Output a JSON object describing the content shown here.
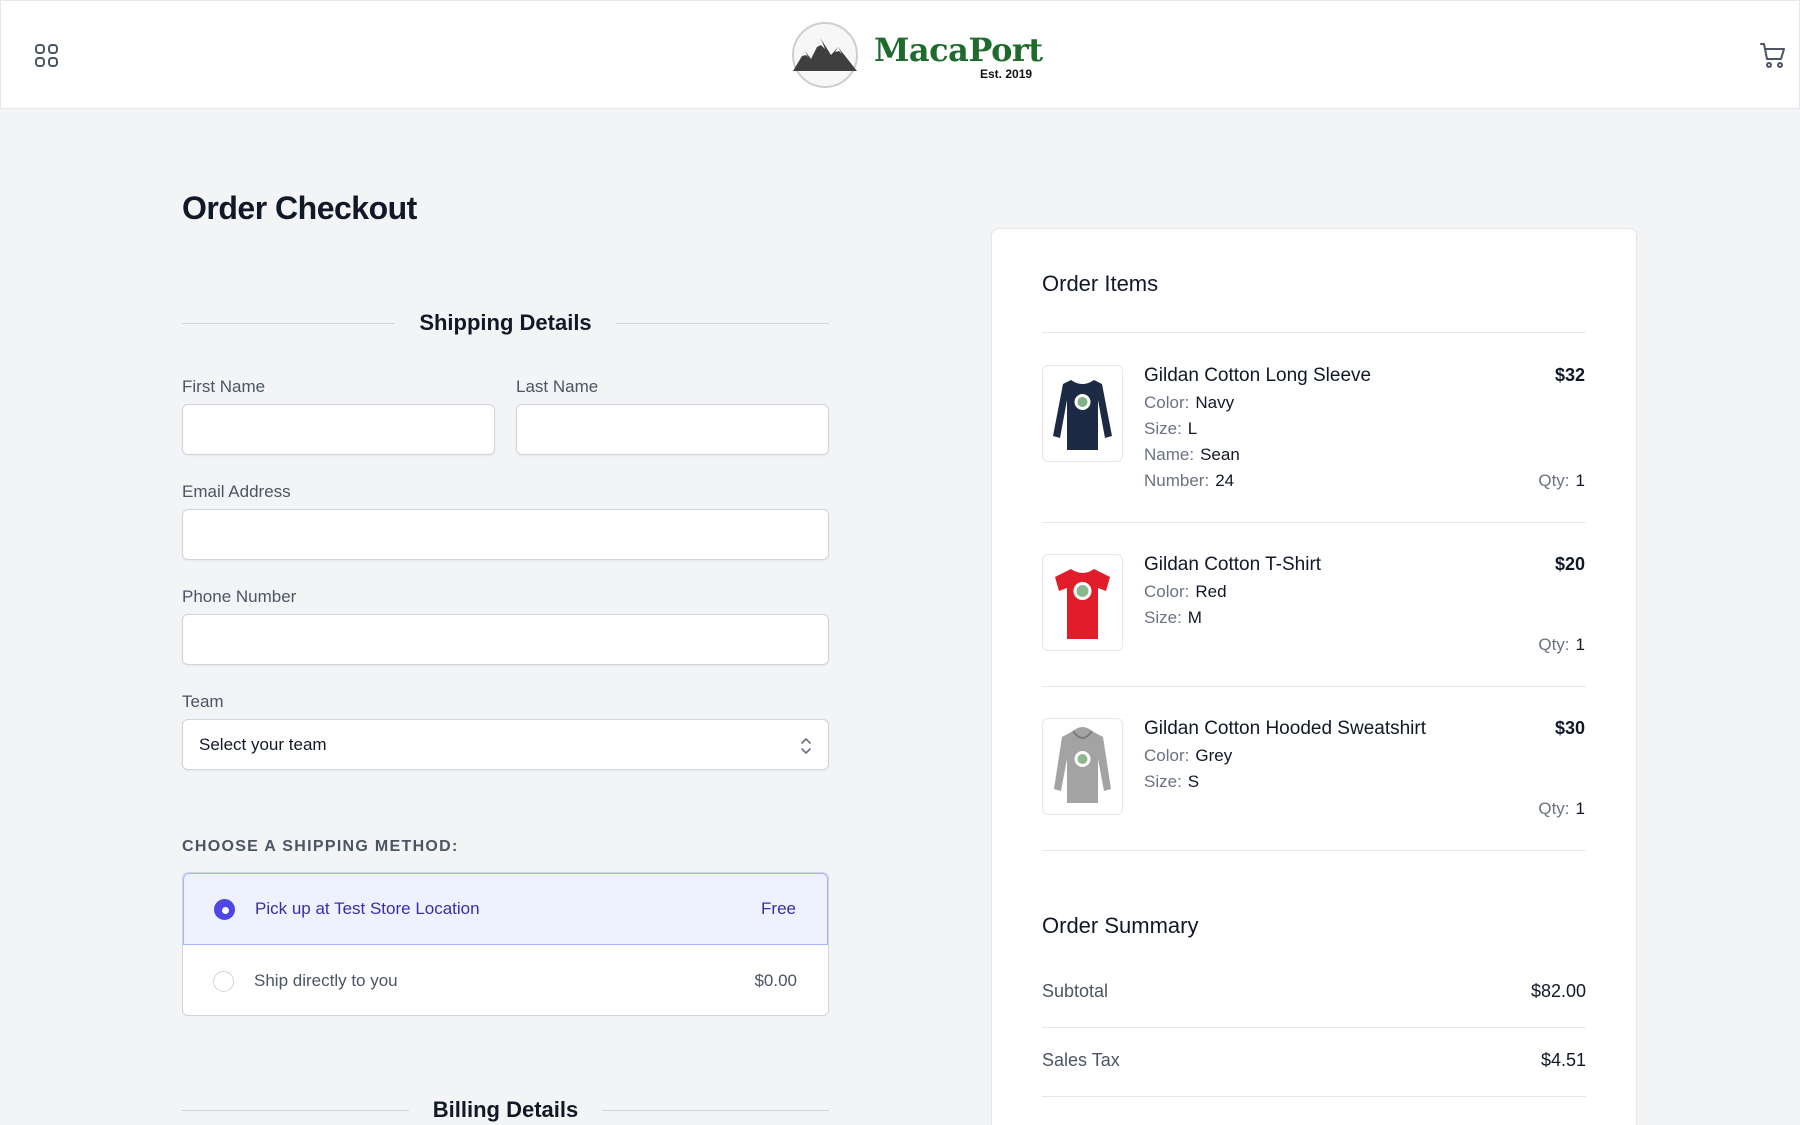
{
  "header": {
    "brand_name": "MacaPort",
    "brand_est": "Est. 2019",
    "menu_icon": "grid-icon",
    "cart_icon": "cart-icon"
  },
  "page": {
    "title": "Order Checkout"
  },
  "shipping": {
    "section_title": "Shipping Details",
    "first_name_label": "First Name",
    "last_name_label": "Last Name",
    "email_label": "Email Address",
    "phone_label": "Phone Number",
    "team_label": "Team",
    "team_value": "Select your team",
    "method_label": "CHOOSE A SHIPPING METHOD:",
    "options": [
      {
        "name": "Pick up at Test Store Location",
        "price": "Free",
        "selected": true
      },
      {
        "name": "Ship directly to you",
        "price": "$0.00",
        "selected": false
      }
    ]
  },
  "billing": {
    "section_title": "Billing Details"
  },
  "order_items": {
    "title": "Order Items",
    "items": [
      {
        "name": "Gildan Cotton Long Sleeve",
        "price": "$32",
        "attrs": [
          {
            "k": "Color:",
            "v": "Navy"
          },
          {
            "k": "Size:",
            "v": "L"
          },
          {
            "k": "Name:",
            "v": "Sean"
          },
          {
            "k": "Number:",
            "v": "24"
          }
        ],
        "qty_label": "Qty:",
        "qty": "1",
        "thumb_color": "#1d2a44"
      },
      {
        "name": "Gildan Cotton T-Shirt",
        "price": "$20",
        "attrs": [
          {
            "k": "Color:",
            "v": "Red"
          },
          {
            "k": "Size:",
            "v": "M"
          }
        ],
        "qty_label": "Qty:",
        "qty": "1",
        "thumb_color": "#e11d2a"
      },
      {
        "name": "Gildan Cotton Hooded Sweatshirt",
        "price": "$30",
        "attrs": [
          {
            "k": "Color:",
            "v": "Grey"
          },
          {
            "k": "Size:",
            "v": "S"
          }
        ],
        "qty_label": "Qty:",
        "qty": "1",
        "thumb_color": "#a3a3a3"
      }
    ]
  },
  "summary": {
    "title": "Order Summary",
    "rows": [
      {
        "k": "Subtotal",
        "v": "$82.00"
      },
      {
        "k": "Sales Tax",
        "v": "$4.51"
      }
    ]
  },
  "colors": {
    "accent": "#4f46e5",
    "brand_green": "#1f6b2e",
    "bg": "#f3f4f6"
  }
}
